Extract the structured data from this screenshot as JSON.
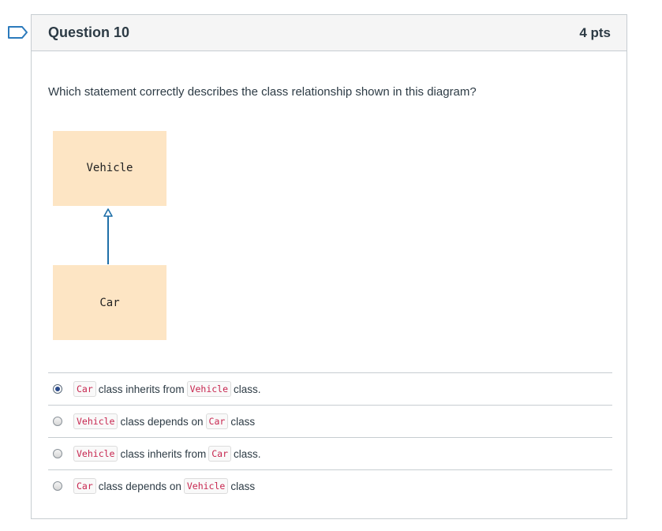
{
  "question": {
    "title": "Question 10",
    "points": "4 pts",
    "text": "Which statement correctly describes the class relationship shown in this diagram?"
  },
  "diagram": {
    "parent_class": "Vehicle",
    "child_class": "Car",
    "box_color": "#fde5c4",
    "arrow_color": "#1f6fa8"
  },
  "answers": [
    {
      "selected": true,
      "a": "Car",
      "verb": "class inherits from",
      "b": "Vehicle",
      "tail": "class."
    },
    {
      "selected": false,
      "a": "Vehicle",
      "verb": "class depends on",
      "b": "Car",
      "tail": "class"
    },
    {
      "selected": false,
      "a": "Vehicle",
      "verb": "class inherits from",
      "b": "Car",
      "tail": "class."
    },
    {
      "selected": false,
      "a": "Car",
      "verb": "class depends on",
      "b": "Vehicle",
      "tail": "class"
    }
  ]
}
